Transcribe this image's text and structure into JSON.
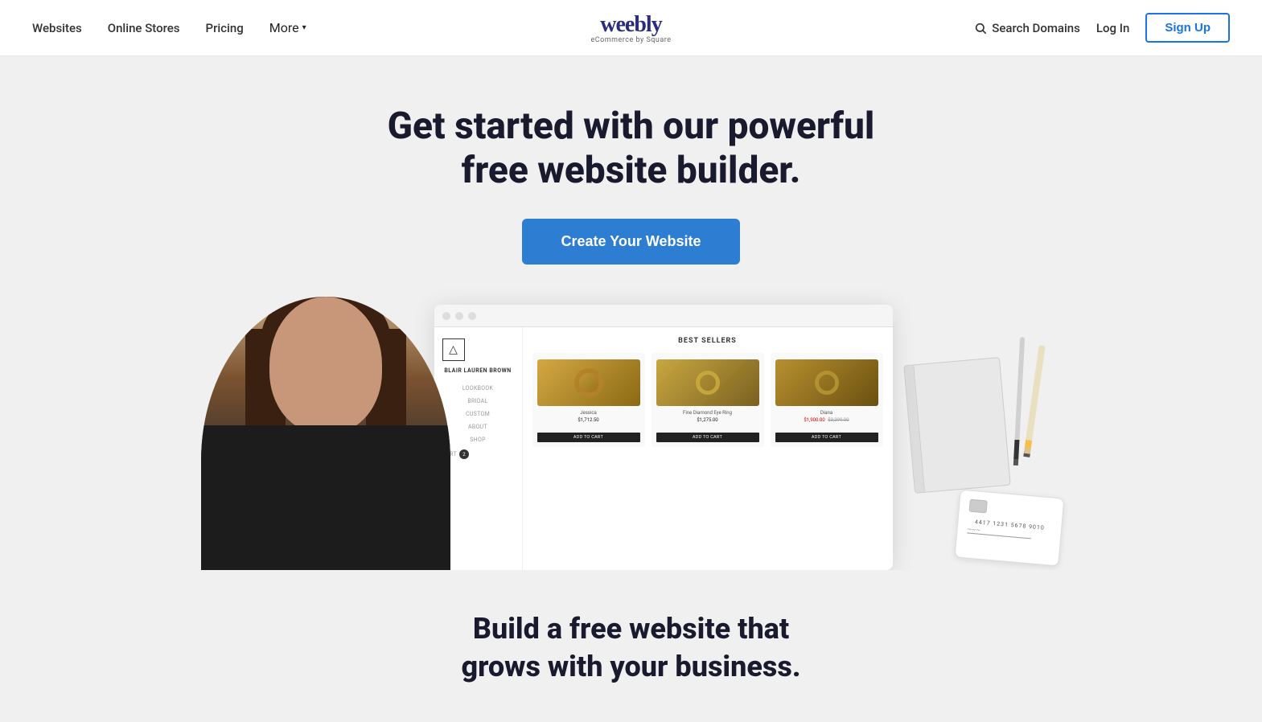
{
  "nav": {
    "links": [
      {
        "id": "websites",
        "label": "Websites"
      },
      {
        "id": "online-stores",
        "label": "Online Stores"
      },
      {
        "id": "pricing",
        "label": "Pricing"
      },
      {
        "id": "more",
        "label": "More"
      }
    ],
    "logo": {
      "wordmark": "weebly",
      "subtext": "eCommerce by Square"
    },
    "search_domains_label": "Search Domains",
    "login_label": "Log In",
    "signup_label": "Sign Up"
  },
  "hero": {
    "headline": "Get started with our powerful free website builder.",
    "cta_label": "Create Your Website"
  },
  "store_mockup": {
    "section_title": "BEST SELLERS",
    "sidebar": {
      "brand": "BLAIR LAUREN BROWN",
      "links": [
        "LOOKBOOK",
        "BRIDAL",
        "CUSTOM",
        "ABOUT",
        "SHOP",
        "CART"
      ]
    },
    "products": [
      {
        "name": "Jessica",
        "price": "$1,712.50",
        "sale_price": null,
        "original_price": null,
        "btn": "ADD TO CART"
      },
      {
        "name": "Fine Diamond Eye Ring",
        "price": "$1,275.00",
        "sale_price": null,
        "original_price": null,
        "btn": "ADD TO CART"
      },
      {
        "name": "Diana",
        "price": null,
        "sale_price": "$1,900.00",
        "original_price": "$3,299.00",
        "btn": "ADD TO CART"
      }
    ]
  },
  "credit_card": {
    "number": "4417 1231 5678 9010"
  },
  "bottom": {
    "headline": "Build a free website that\ngrows with your business."
  }
}
